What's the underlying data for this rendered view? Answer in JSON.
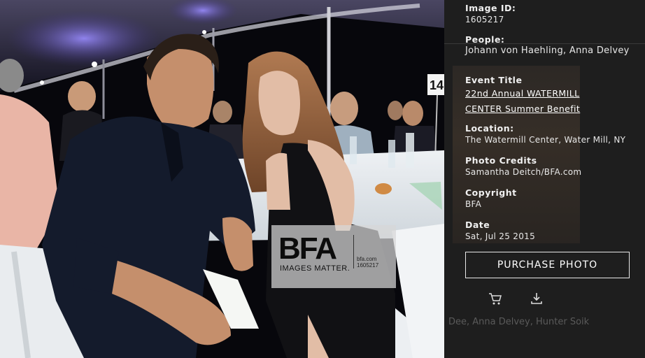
{
  "photo": {
    "alt_logo": "BFA",
    "tagline": "IMAGES MATTER.",
    "site": "bfa.com",
    "id": "1605217",
    "table_number": "14"
  },
  "details": {
    "image_id_label": "Image ID:",
    "image_id": "1605217",
    "people_label": "People:",
    "people": "Johann von Haehling, Anna Delvey",
    "event_label": "Event Title",
    "event_line1": "22nd Annual WATERMILL",
    "event_line2": "CENTER Summer Benefit",
    "location_label": "Location:",
    "location": "The Watermill Center, Water Mill, NY",
    "credits_label": "Photo Credits",
    "credits": "Samantha Deitch/BFA.com",
    "copyright_label": "Copyright",
    "copyright": "BFA",
    "date_label": "Date",
    "date": "Sat, Jul 25 2015"
  },
  "actions": {
    "purchase_label": "PURCHASE PHOTO",
    "cart_icon": "cart-icon",
    "download_icon": "download-icon"
  },
  "background": {
    "names_text": "Dee, Anna Delvey, Hunter Soik"
  }
}
